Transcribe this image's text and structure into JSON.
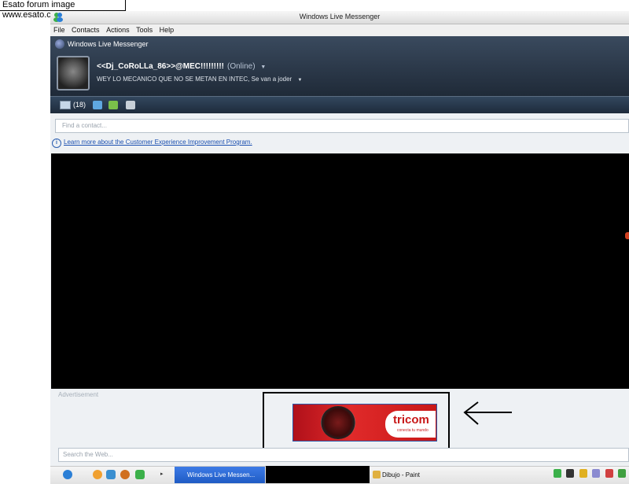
{
  "watermark": {
    "text": "Esato forum image www.esato.com"
  },
  "window": {
    "title": "Windows Live Messenger"
  },
  "menu": {
    "items": [
      "File",
      "Contacts",
      "Actions",
      "Tools",
      "Help"
    ]
  },
  "header": {
    "brand": "Windows Live Messenger",
    "display_name": "<<Dj_CoRoLLa_86>>@MEC!!!!!!!!!",
    "status": "(Online)",
    "personal_message": "WEY LO MECANICO QUE NO SE METAN EN INTEC, Se van a joder"
  },
  "toolbar": {
    "mail_count": "(18)"
  },
  "contacts": {
    "search_placeholder": "Find a contact..."
  },
  "notice": {
    "link_text": "Learn more about the Customer Experience Improvement Program."
  },
  "ad": {
    "label": "Advertisement",
    "brand": "tricom",
    "tagline": "conecta tu mundo"
  },
  "web_search": {
    "placeholder": "Search the Web..."
  },
  "taskbar": {
    "messenger_task": "Windows Live Messen...",
    "paint_task": "Dibujo - Paint"
  },
  "colors": {
    "header_bg": "#2a384a",
    "taskbar_active": "#2a66d0",
    "ad_red": "#c81818",
    "link": "#1a4fb0"
  },
  "icons": {
    "title_app": "messenger-buddies-icon",
    "mail": "mail-icon",
    "tray": [
      "messenger-tray-icon",
      "network-icon",
      "shield-icon",
      "volume-icon",
      "antivirus-icon",
      "update-icon"
    ]
  }
}
